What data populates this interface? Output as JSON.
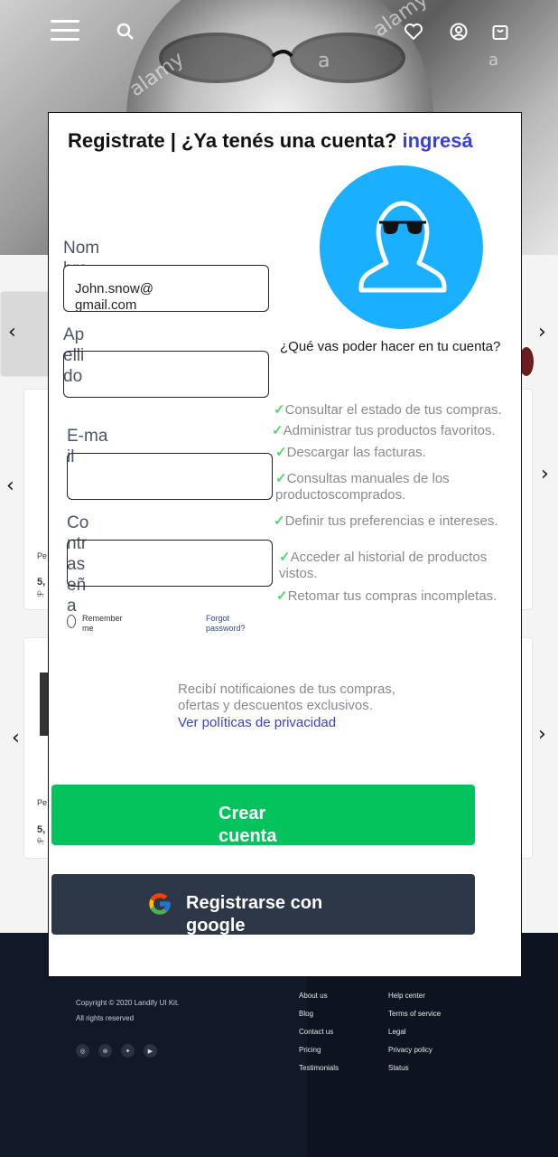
{
  "header": {
    "watermark_1": "alamy",
    "watermark_2": "alamy",
    "watermark_3": "a",
    "watermark_4": "a"
  },
  "background": {
    "price_1": "5,",
    "price_2": "5,",
    "old_price_1": "9,",
    "old_price_2": "9,",
    "label_1": "Pe",
    "label_2": "Pe"
  },
  "modal": {
    "title": "Registrate | ¿Ya tenés una cuenta? ",
    "title_link": "ingresá",
    "fields": [
      {
        "label": "Nom\nbre",
        "value": "John.snow@\ngmail.com"
      },
      {
        "label": "Ap\nelli\ndo",
        "value": ""
      },
      {
        "label": "E-ma\nil",
        "value": ""
      },
      {
        "label": "Co\nntr\nas\neñ\na",
        "value": ""
      }
    ],
    "remember": "Remember\nme",
    "forgot": "Forgot\npassword?",
    "question": "¿Qué vas poder hacer en tu cuenta?",
    "benefits": [
      "Consultar el estado de tus compras.",
      "Administrar tus productos favoritos.",
      "Descargar las facturas.",
      "Consultas manuales de los\nproductoscomprados.",
      "Definir tus preferencias e intereses.",
      "Acceder al historial de productos\nvistos.",
      "Retomar tus compras incompletas."
    ],
    "check": "✓",
    "notice": "Recibí notificaiones de tus compras,\nofertas y descuentos exclusivos.",
    "privacy_link": "Ver políticas de privacidad",
    "create_button": "Crear\ncuenta",
    "google_button": "Registrarse con\ngoogle"
  },
  "footer": {
    "copyright": "Copyright © 2020 Landify UI Kit.",
    "rights": "All rights reserved",
    "col1": [
      "About us",
      "Blog",
      "Contact us",
      "Pricing",
      "Testimonials"
    ],
    "col2": [
      "Help center",
      "Terms of service",
      "Legal",
      "Privacy policy",
      "Status"
    ]
  },
  "colors": {
    "accent_link": "#3a3fd6",
    "primary_button": "#04c35c",
    "google_button": "#2d3748",
    "avatar": "#1ab0ff",
    "check": "#4cd964"
  }
}
